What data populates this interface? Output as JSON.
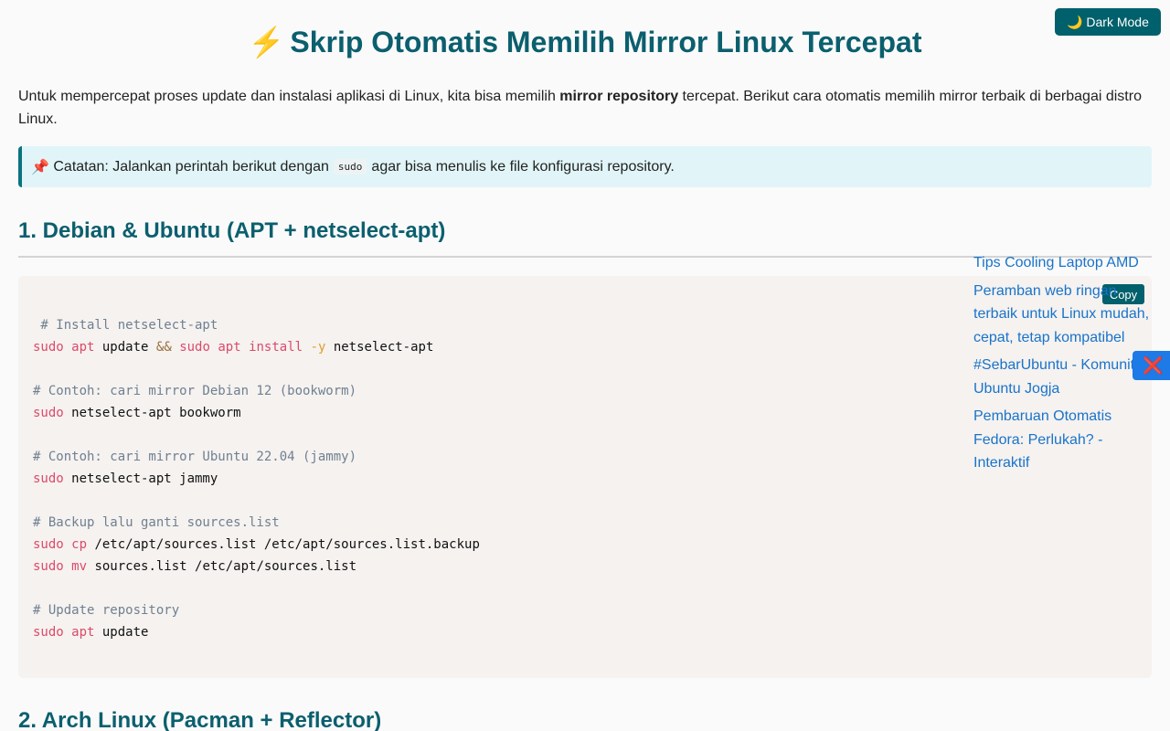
{
  "header": {
    "dark_mode_label": "🌙 Dark Mode",
    "title_icon": "⚡",
    "title": "Skrip Otomatis Memilih Mirror Linux Tercepat"
  },
  "intro": {
    "before": "Untuk mempercepat proses update dan instalasi aplikasi di Linux, kita bisa memilih ",
    "bold": "mirror repository",
    "after": " tercepat. Berikut cara otomatis memilih mirror terbaik di berbagai distro Linux."
  },
  "note": {
    "icon": "📌",
    "before": "Catatan: Jalankan perintah berikut dengan ",
    "code": "sudo",
    "after": " agar bisa menulis ke file konfigurasi repository."
  },
  "sections": [
    {
      "heading": "1. Debian & Ubuntu (APT + netselect-apt)",
      "copy_label": "Copy",
      "code_lines": [
        [
          {
            "t": " # Install netselect-apt",
            "c": "comment"
          }
        ],
        [
          {
            "t": "sudo",
            "c": "kw"
          },
          {
            "t": " "
          },
          {
            "t": "apt",
            "c": "kw"
          },
          {
            "t": " update "
          },
          {
            "t": "&&",
            "c": "op"
          },
          {
            "t": " "
          },
          {
            "t": "sudo",
            "c": "kw"
          },
          {
            "t": " "
          },
          {
            "t": "apt",
            "c": "kw"
          },
          {
            "t": " "
          },
          {
            "t": "install",
            "c": "kw"
          },
          {
            "t": " "
          },
          {
            "t": "-y",
            "c": "flag"
          },
          {
            "t": " netselect-apt"
          }
        ],
        [],
        [
          {
            "t": "# Contoh: cari mirror Debian 12 (bookworm)",
            "c": "comment"
          }
        ],
        [
          {
            "t": "sudo",
            "c": "kw"
          },
          {
            "t": " netselect-apt bookworm"
          }
        ],
        [],
        [
          {
            "t": "# Contoh: cari mirror Ubuntu 22.04 (jammy)",
            "c": "comment"
          }
        ],
        [
          {
            "t": "sudo",
            "c": "kw"
          },
          {
            "t": " netselect-apt jammy"
          }
        ],
        [],
        [
          {
            "t": "# Backup lalu ganti sources.list",
            "c": "comment"
          }
        ],
        [
          {
            "t": "sudo",
            "c": "kw"
          },
          {
            "t": " "
          },
          {
            "t": "cp",
            "c": "kw"
          },
          {
            "t": " /etc/apt/sources.list /etc/apt/sources.list.backup"
          }
        ],
        [
          {
            "t": "sudo",
            "c": "kw"
          },
          {
            "t": " "
          },
          {
            "t": "mv",
            "c": "kw"
          },
          {
            "t": " sources.list /etc/apt/sources.list"
          }
        ],
        [],
        [
          {
            "t": "# Update repository",
            "c": "comment"
          }
        ],
        [
          {
            "t": "sudo",
            "c": "kw"
          },
          {
            "t": " "
          },
          {
            "t": "apt",
            "c": "kw"
          },
          {
            "t": " update"
          }
        ]
      ]
    },
    {
      "heading": "2. Arch Linux (Pacman + Reflector)"
    }
  ],
  "related_links": [
    "Tips Cooling Laptop AMD",
    "Peramban web ringan terbaik untuk Linux mudah, cepat, tetap kompatibel",
    "#SebarUbuntu - Komunitas Ubuntu Jogja",
    "Pembaruan Otomatis Fedora: Perlukah? - Interaktif"
  ],
  "close_icon": "❌",
  "colors": {
    "accent": "#00606b",
    "heading": "#0b5f6e",
    "link": "#1a73c9",
    "note_bg": "#e1f5f8",
    "code_bg": "#f5f2f0",
    "float_button": "#1e7ae6"
  }
}
